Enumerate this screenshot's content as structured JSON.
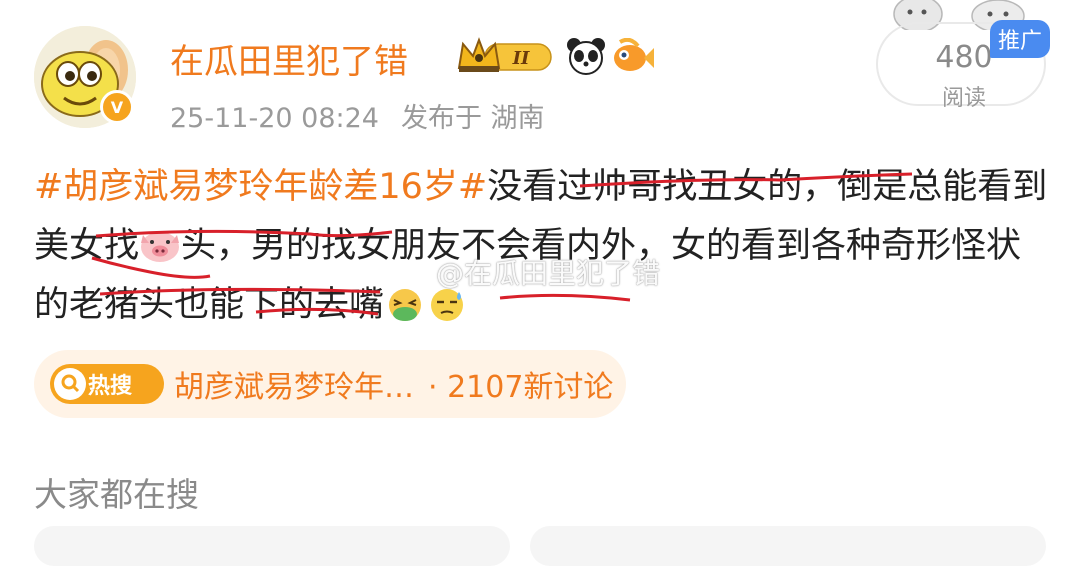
{
  "user": {
    "name": "在瓜田里犯了错",
    "verified_badge": "V",
    "level_badge": "II"
  },
  "meta": {
    "timestamp": "25-11-20 08:24",
    "location": "发布于 湖南"
  },
  "read": {
    "count": "480",
    "label": "阅读",
    "promo": "推广"
  },
  "post": {
    "hashtag": "#胡彦斌易梦玲年龄差16岁#",
    "seg1": "没看过帅哥找丑女的，倒是总能看到美女找",
    "emoji_pig": "pig-face-icon",
    "seg2": "头，男的找女朋友不会看内外，女的看到各种奇形怪状的老猪头也能下的去嘴",
    "emoji_nauseated": "nauseated-face-icon",
    "emoji_sweat": "downcast-sweat-face-icon"
  },
  "watermark": "@在瓜田里犯了错",
  "hot": {
    "badge": "热搜",
    "topic": "胡彦斌易梦玲年…",
    "count": "· 2107新讨论"
  },
  "section": {
    "title": "大家都在搜"
  },
  "colors": {
    "accent": "#f07a1e",
    "badge_orange": "#f6a41e",
    "promo_blue": "#4a8bf0",
    "strike_red": "#d8202a"
  }
}
